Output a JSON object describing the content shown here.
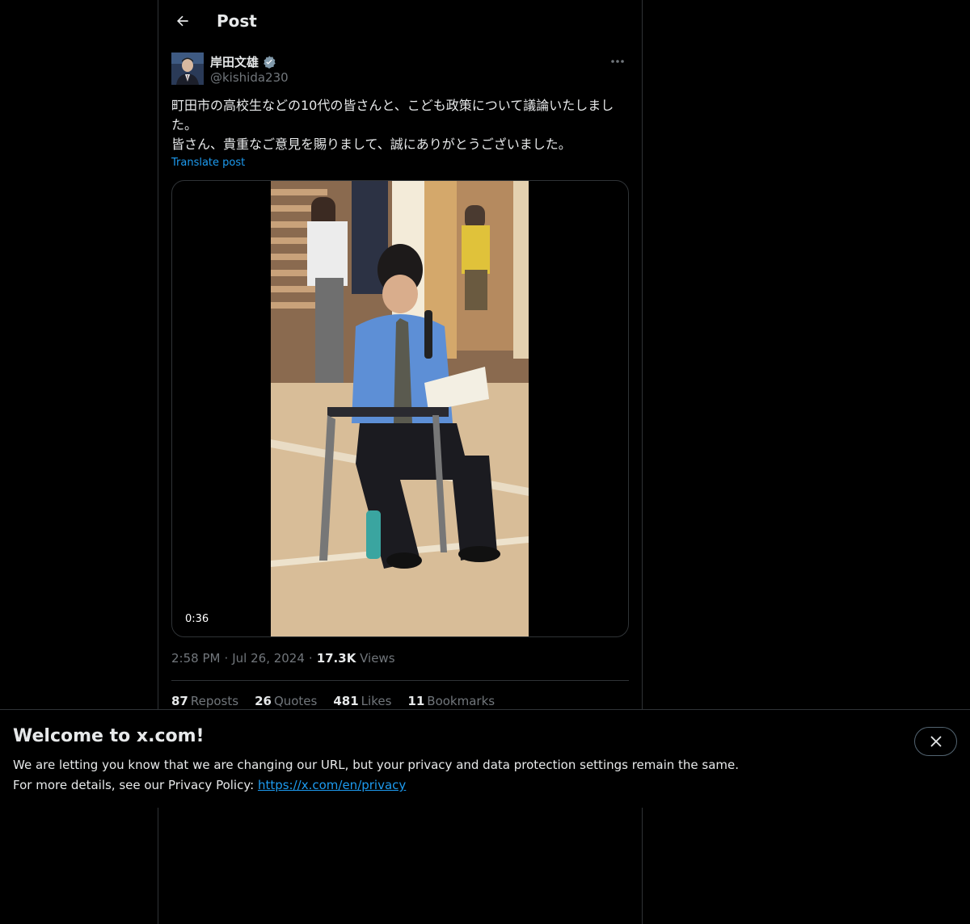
{
  "header": {
    "title": "Post",
    "back_icon": "arrow-left-icon"
  },
  "author": {
    "display_name": "岸田文雄",
    "handle": "@kishida230",
    "verified_icon": "verified-badge-icon",
    "more_icon": "more-horizontal-icon"
  },
  "tweet": {
    "text": "町田市の高校生などの10代の皆さんと、こども政策について議論いたしました。\n皆さん、貴重なご意見を賜りまして、誠にありがとうございました。",
    "translate_label": "Translate post"
  },
  "media": {
    "duration": "0:36"
  },
  "meta": {
    "time": "2:58 PM",
    "separator": "·",
    "date": "Jul 26, 2024",
    "views_count": "17.3K",
    "views_label": "Views"
  },
  "stats": {
    "reposts_count": "87",
    "reposts_label": "Reposts",
    "quotes_count": "26",
    "quotes_label": "Quotes",
    "likes_count": "481",
    "likes_label": "Likes",
    "bookmarks_count": "11",
    "bookmarks_label": "Bookmarks"
  },
  "banner": {
    "title": "Welcome to x.com!",
    "line1": "We are letting you know that we are changing our URL, but your privacy and data protection settings remain the same.",
    "line2_prefix": "For more details, see our Privacy Policy: ",
    "link": "https://x.com/en/privacy",
    "close_icon": "close-icon"
  },
  "colors": {
    "background": "#000000",
    "text": "#e7e9ea",
    "muted": "#71767b",
    "accent": "#1d9bf0",
    "border": "#2f3336"
  }
}
